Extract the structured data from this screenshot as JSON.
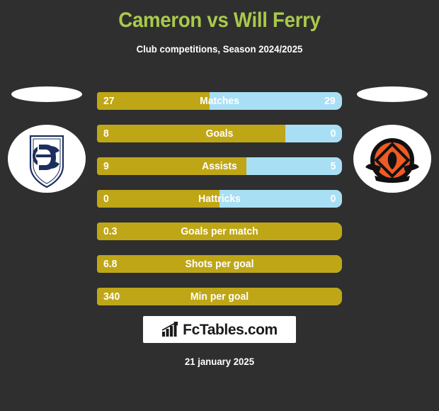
{
  "header": {
    "title": "Cameron vs Will Ferry",
    "subtitle": "Club competitions, Season 2024/2025"
  },
  "teams": {
    "home": {
      "name": "Dundee FC",
      "icon": "dundee-fc-crest",
      "colors": {
        "primary": "#1c2f5e",
        "background": "#ffffff"
      }
    },
    "away": {
      "name": "Dundee United FC",
      "icon": "dundee-united-crest",
      "colors": {
        "primary": "#f05a23",
        "secondary": "#111111",
        "background": "#ffffff"
      }
    }
  },
  "theme": {
    "background": "#2f2f2f",
    "title_color": "#a9c94b",
    "home_bar_color": "#bfa617",
    "away_bar_color": "#a9dff5",
    "text_color": "#ffffff"
  },
  "chart_data": {
    "type": "bar",
    "title": "Cameron vs Will Ferry",
    "subtitle": "Club competitions, Season 2024/2025",
    "orientation": "horizontal-diverging",
    "series": [
      {
        "name": "Cameron",
        "values": [
          27,
          8,
          9,
          0,
          0.3,
          6.8,
          340
        ]
      },
      {
        "name": "Will Ferry",
        "values": [
          29,
          0,
          5,
          0,
          null,
          null,
          null
        ]
      }
    ],
    "categories": [
      "Matches",
      "Goals",
      "Assists",
      "Hattricks",
      "Goals per match",
      "Shots per goal",
      "Min per goal"
    ],
    "rows": [
      {
        "label": "Matches",
        "home": "27",
        "away": "29",
        "home_pct": 46,
        "has_away": true
      },
      {
        "label": "Goals",
        "home": "8",
        "away": "0",
        "home_pct": 77,
        "has_away": true
      },
      {
        "label": "Assists",
        "home": "9",
        "away": "5",
        "home_pct": 61,
        "has_away": true
      },
      {
        "label": "Hattricks",
        "home": "0",
        "away": "0",
        "home_pct": 50,
        "has_away": true
      },
      {
        "label": "Goals per match",
        "home": "0.3",
        "away": "",
        "home_pct": 100,
        "has_away": false
      },
      {
        "label": "Shots per goal",
        "home": "6.8",
        "away": "",
        "home_pct": 100,
        "has_away": false
      },
      {
        "label": "Min per goal",
        "home": "340",
        "away": "",
        "home_pct": 100,
        "has_away": false
      }
    ],
    "legend": [
      "Cameron",
      "Will Ferry"
    ],
    "grid": false
  },
  "footer": {
    "brand": "FcTables.com",
    "brand_icon": "bar-chart-icon",
    "date": "21 january 2025"
  }
}
